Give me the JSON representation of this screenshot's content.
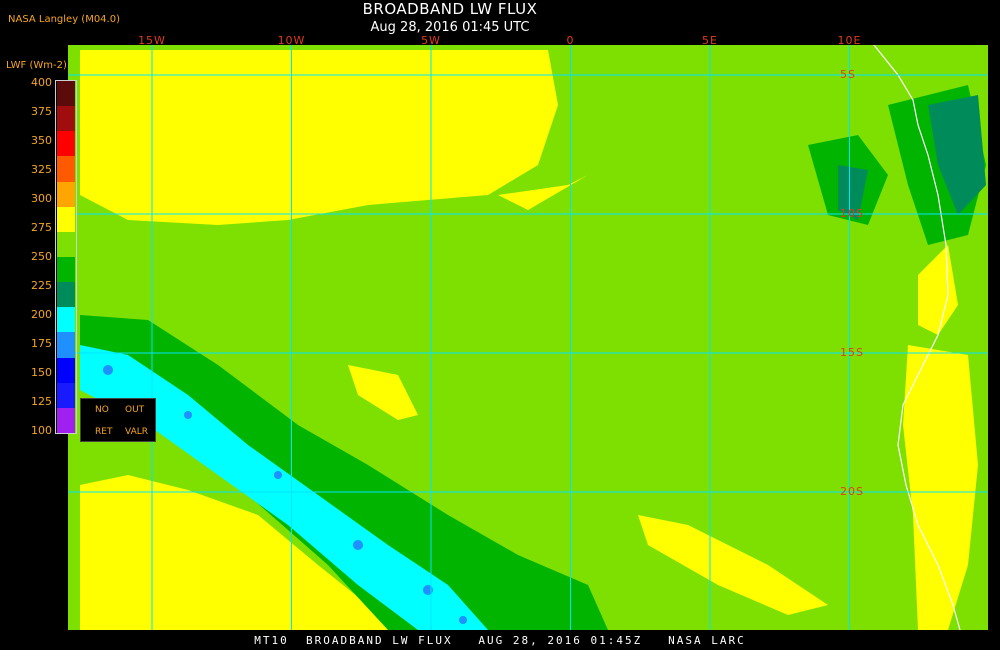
{
  "header": {
    "source": "NASA Langley (M04.0)",
    "title": "BROADBAND LW FLUX",
    "subtitle": "Aug 28, 2016 01:45 UTC"
  },
  "map": {
    "lon_labels": [
      {
        "text": "15W",
        "lon": -15
      },
      {
        "text": "10W",
        "lon": -10
      },
      {
        "text": "5W",
        "lon": -5
      },
      {
        "text": "0",
        "lon": 0
      },
      {
        "text": "5E",
        "lon": 5
      },
      {
        "text": "10E",
        "lon": 10
      }
    ],
    "lat_labels": [
      {
        "text": "5S",
        "lat": -5
      },
      {
        "text": "10S",
        "lat": -10
      },
      {
        "text": "15S",
        "lat": -15
      },
      {
        "text": "20S",
        "lat": -20
      }
    ],
    "grid_color": "#00e5ff",
    "coast_color": "#ffffff"
  },
  "legend": {
    "unit": "LWF (Wm-2)",
    "ticks": [
      "400",
      "375",
      "350",
      "325",
      "300",
      "275",
      "250",
      "225",
      "200",
      "175",
      "150",
      "125",
      "100"
    ],
    "colors": [
      "#5c0b0b",
      "#a10d0d",
      "#ff0000",
      "#ff5a00",
      "#ffa500",
      "#ffff00",
      "#7de000",
      "#00b400",
      "#008c5a",
      "#00ffff",
      "#1e90ff",
      "#0000ff",
      "#1a1aff",
      "#a020f0"
    ],
    "codes": [
      "NO",
      "OUT",
      "RET",
      "VALR"
    ]
  },
  "colors": {
    "yellow": "#ffff00",
    "lime": "#7de000",
    "green": "#00b400",
    "teal": "#008c5a",
    "cyan": "#00ffff",
    "blue": "#1e90ff"
  },
  "footer": "MT10  BROADBAND LW FLUX   AUG 28, 2016 01:45Z   NASA LARC"
}
